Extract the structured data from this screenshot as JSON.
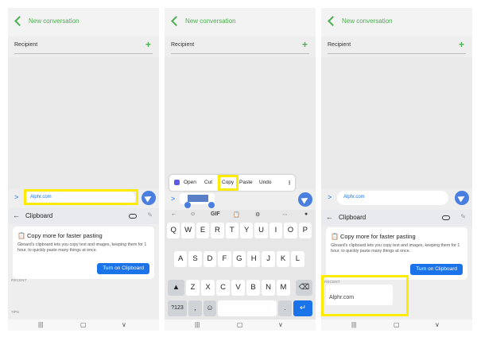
{
  "header": {
    "title": "New conversation"
  },
  "recipient": {
    "label": "Recipient"
  },
  "message": {
    "text": "Alphr.com"
  },
  "selection_menu": {
    "open": "Open",
    "cut": "Cut",
    "copy": "Copy",
    "paste": "Paste",
    "undo": "Undo"
  },
  "clipboard": {
    "title": "Clipboard",
    "card_title": "Copy more for faster pasting",
    "card_body": "Gboard's clipboard lets you copy text and images, keeping them for 1 hour, to quickly paste many things at once.",
    "button": "Turn on Clipboard",
    "recent_label": "RECENT",
    "tips_label": "TIPS",
    "recent_item": "Alphr.com"
  },
  "keyboard": {
    "row1": [
      "Q",
      "W",
      "E",
      "R",
      "T",
      "Y",
      "U",
      "I",
      "O",
      "P"
    ],
    "row2": [
      "A",
      "S",
      "D",
      "F",
      "G",
      "H",
      "J",
      "K",
      "L"
    ],
    "row3": [
      "Z",
      "X",
      "C",
      "V",
      "B",
      "N",
      "M"
    ],
    "num_key": "?123",
    "comma": ",",
    "period": ".",
    "gif": "GIF"
  },
  "colors": {
    "accent_green": "#4caf50",
    "accent_blue": "#1a73e8",
    "highlight": "#ffeb00"
  }
}
